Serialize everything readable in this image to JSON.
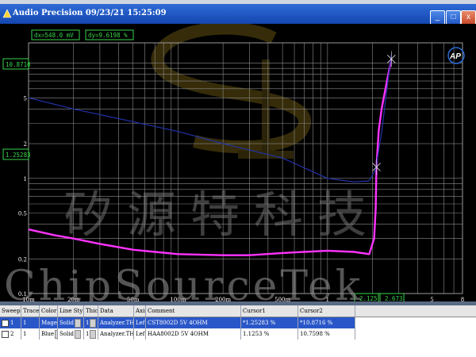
{
  "window": {
    "title": "Audio Precision  09/23/21 15:25:09",
    "min_label": "_",
    "max_label": "□",
    "close_label": "x"
  },
  "readouts": {
    "dx": "dx=548.0   mV",
    "dy": "dy=9.6198   %",
    "cursor2_y": "10.8716",
    "cursor1_y": "1.25283",
    "cursor1_x": "2.125",
    "cursor2_x": "2.673"
  },
  "logo": "AP",
  "watermark": {
    "cn": "矽源特科技",
    "en": "ChipSourceTek"
  },
  "colors": {
    "magenta": "#ff33ff",
    "blue": "#2233aa",
    "grid": "#8c8c8c",
    "readout": "#39d44a"
  },
  "chart_data": {
    "type": "line",
    "xscale": "log",
    "yscale": "log",
    "xlim": [
      0.01,
      8
    ],
    "ylim": [
      0.1,
      15
    ],
    "x_tick_labels": [
      "10m",
      "20m",
      "50m",
      "100m",
      "200m",
      "500m",
      "1",
      "2",
      "5",
      "8"
    ],
    "y_tick_labels": [
      "10",
      "5",
      "2",
      "1",
      "0.5",
      "0.2",
      "0.1"
    ],
    "grid": true,
    "series": [
      {
        "color": "magenta",
        "x": [
          0.01,
          0.015,
          0.02,
          0.03,
          0.05,
          0.07,
          0.1,
          0.2,
          0.3,
          0.5,
          0.7,
          1.0,
          1.5,
          1.9,
          2.05,
          2.1,
          2.125,
          2.2,
          2.3,
          2.5,
          2.673
        ],
        "y": [
          0.36,
          0.32,
          0.3,
          0.27,
          0.24,
          0.23,
          0.22,
          0.215,
          0.215,
          0.225,
          0.23,
          0.235,
          0.23,
          0.22,
          0.3,
          0.55,
          1.25283,
          2.6,
          4.0,
          7.0,
          10.8716
        ]
      },
      {
        "color": "blue",
        "x": [
          0.01,
          0.02,
          0.05,
          0.1,
          0.2,
          0.5,
          1.0,
          1.5,
          1.9,
          2.1,
          2.3,
          2.5,
          2.673
        ],
        "y": [
          5.0,
          4.0,
          3.1,
          2.55,
          2.0,
          1.5,
          1.0,
          0.93,
          0.95,
          1.2,
          2.5,
          6.0,
          12.0
        ]
      }
    ]
  },
  "table": {
    "headers": [
      "Sweep",
      "Trace",
      "Color",
      "Line Style",
      "Thick",
      "Data",
      "Axis",
      "Comment",
      "Cursor1",
      "Cursor2"
    ],
    "rows": [
      {
        "sweep": "1",
        "trace": "1",
        "color": "Mage",
        "line_style": "Solid",
        "thick": "1",
        "data": "Analyzer.THD+",
        "axis": "Left",
        "comment": "CST8002D 5V 4OHM",
        "cursor1": "*1.25283  %",
        "cursor2": "*10.8716  %"
      },
      {
        "sweep": "2",
        "trace": "1",
        "color": "Blue",
        "line_style": "Solid",
        "thick": "1",
        "data": "Analyzer.THD+N",
        "axis": "Left",
        "comment": "HAA8002D 5V 4OHM",
        "cursor1": "1.1253  %",
        "cursor2": "10.7598  %"
      }
    ]
  }
}
